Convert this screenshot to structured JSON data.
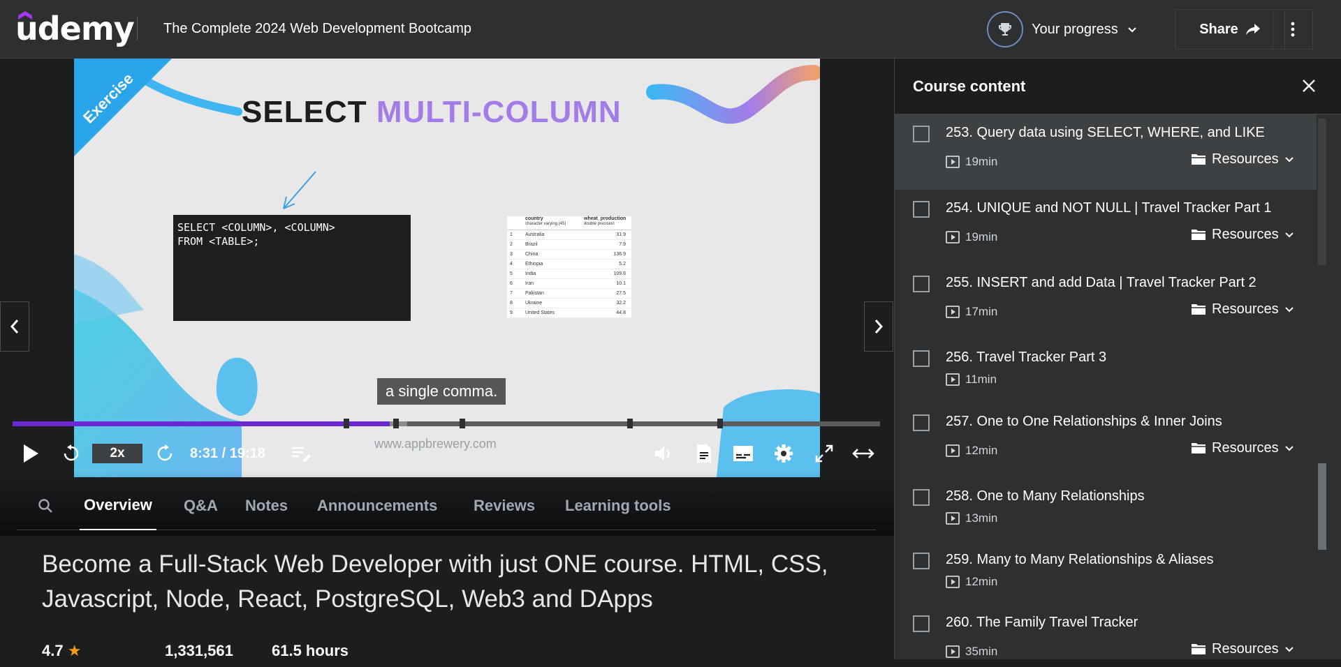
{
  "header": {
    "logo": "udemy",
    "course_title": "The Complete 2024 Web Development Bootcamp",
    "progress_label": "Your progress",
    "share_label": "Share"
  },
  "video": {
    "slide_title_part1": "SELECT",
    "slide_title_part2": "MULTI-COLUMN",
    "exercise_label": "Exercise",
    "code_line1": "SELECT <COLUMN>, <COLUMN>",
    "code_line2": "FROM <TABLE>;",
    "table_headers": [
      "country",
      "wheat_production"
    ],
    "table_subheaders": [
      "character varying (45)",
      "double precision"
    ],
    "table_rows": [
      [
        "1",
        "Australia",
        "31.9"
      ],
      [
        "2",
        "Brazil",
        "7.9"
      ],
      [
        "3",
        "China",
        "136.9"
      ],
      [
        "4",
        "Ethiopia",
        "5.2"
      ],
      [
        "5",
        "India",
        "109.6"
      ],
      [
        "6",
        "Iran",
        "10.1"
      ],
      [
        "7",
        "Pakistan",
        "27.5"
      ],
      [
        "8",
        "Ukraine",
        "32.2"
      ],
      [
        "9",
        "United States",
        "44.8"
      ]
    ],
    "watermark": "www.appbrewery.com",
    "caption": "a single comma.",
    "speed": "2x",
    "time": "8:31 / 19:18",
    "progress": 0.435,
    "buffered": 0.455,
    "accent_color": "#6d28d2"
  },
  "tabs": [
    "Overview",
    "Q&A",
    "Notes",
    "Announcements",
    "Reviews",
    "Learning tools"
  ],
  "active_tab": "Overview",
  "headline": "Become a Full-Stack Web Developer with just ONE course. HTML, CSS, Javascript, Node, React, PostgreSQL, Web3 and DApps",
  "stats": {
    "rating": "4.7",
    "students": "1,331,561",
    "hours": "61.5 hours"
  },
  "sidebar": {
    "title": "Course content",
    "lessons": [
      {
        "title": "253. Query data using SELECT, WHERE, and LIKE",
        "duration": "19min",
        "resources": "Resources"
      },
      {
        "title": "254. UNIQUE and NOT NULL | Travel Tracker Part 1",
        "duration": "19min",
        "resources": "Resources"
      },
      {
        "title": "255. INSERT and add Data | Travel Tracker Part 2",
        "duration": "17min",
        "resources": "Resources"
      },
      {
        "title": "256. Travel Tracker Part 3",
        "duration": "11min",
        "resources": ""
      },
      {
        "title": "257. One to One Relationships & Inner Joins",
        "duration": "12min",
        "resources": "Resources"
      },
      {
        "title": "258. One to Many Relationships",
        "duration": "13min",
        "resources": ""
      },
      {
        "title": "259. Many to Many Relationships & Aliases",
        "duration": "12min",
        "resources": ""
      },
      {
        "title": "260. The Family Travel Tracker",
        "duration": "35min",
        "resources": "Resources"
      }
    ]
  }
}
